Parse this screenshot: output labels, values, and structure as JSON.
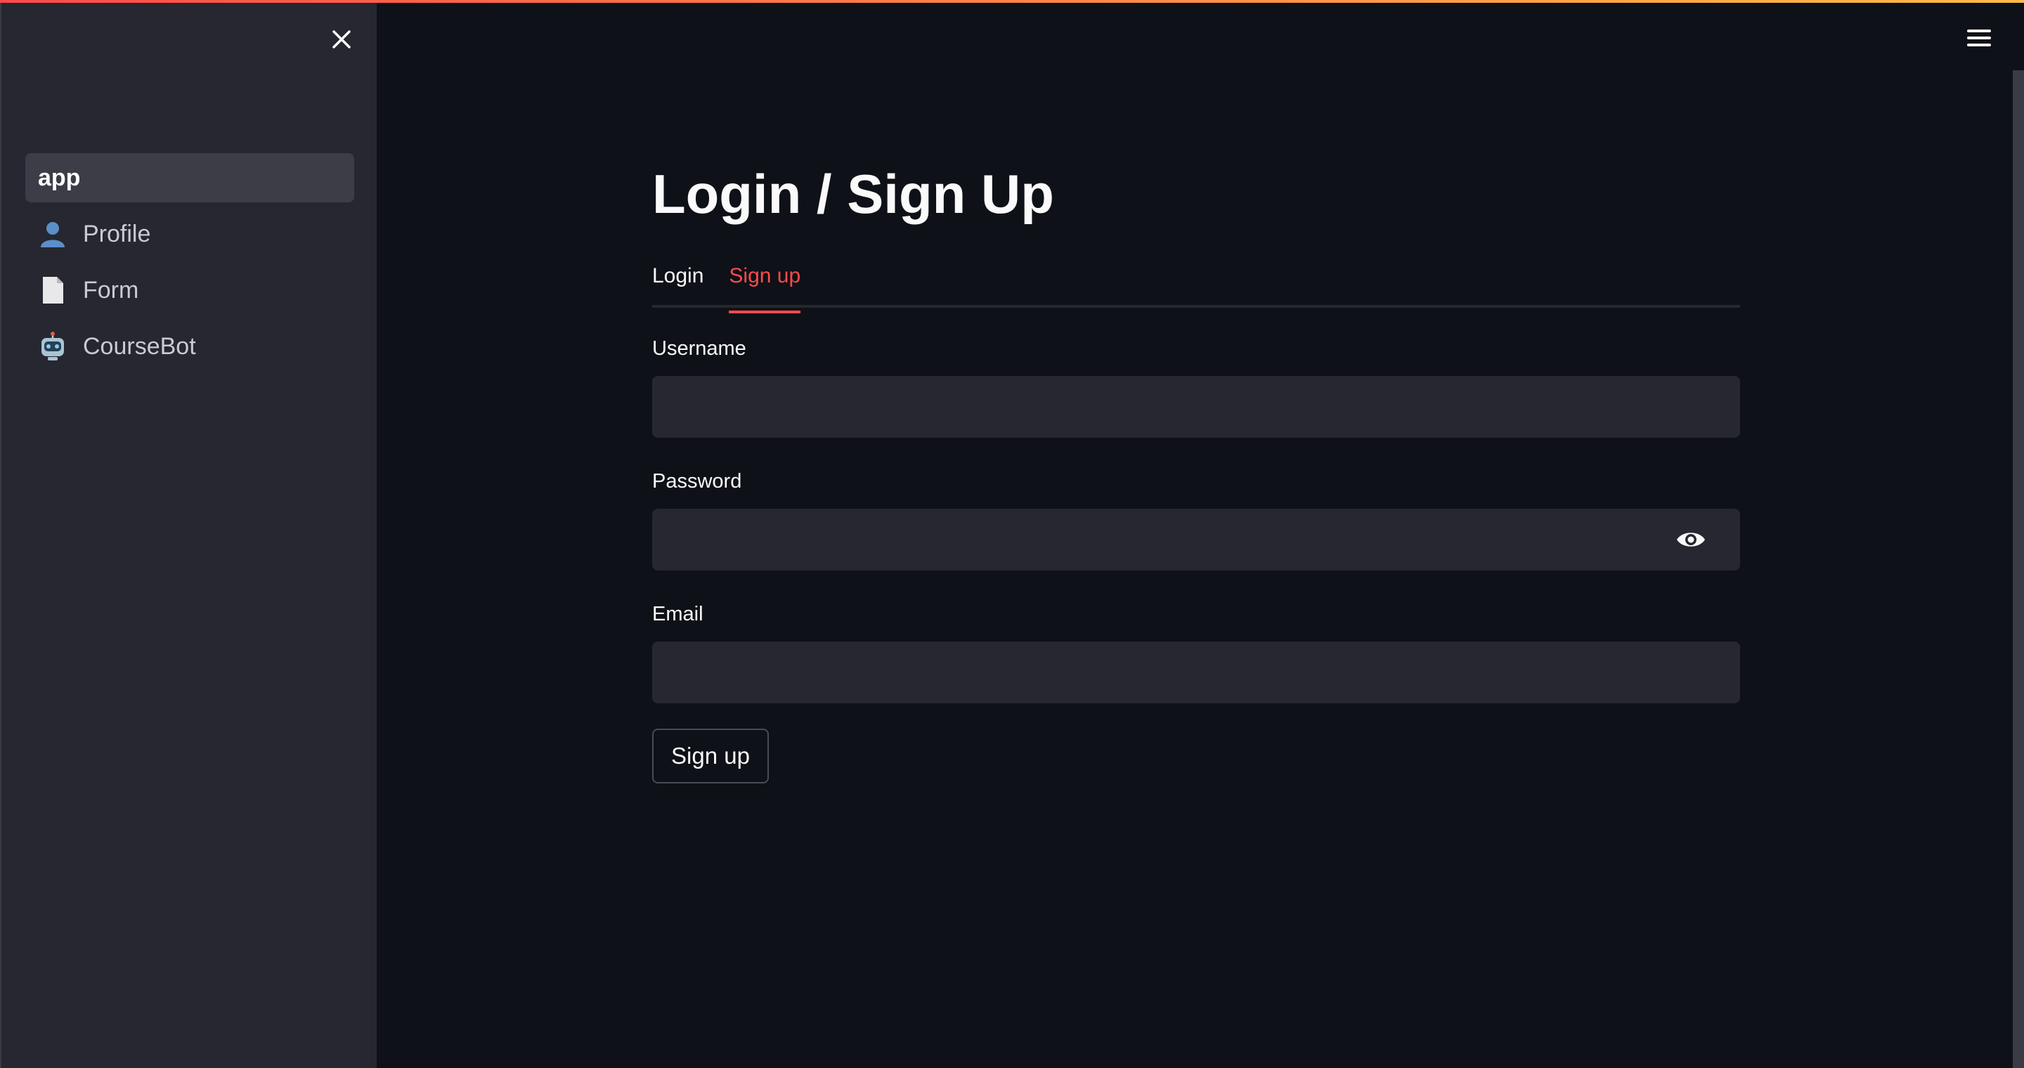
{
  "sidebar": {
    "items": [
      {
        "label": "app",
        "icon": ""
      },
      {
        "label": "Profile",
        "icon": "bust-in-silhouette-icon"
      },
      {
        "label": "Form",
        "icon": "page-icon"
      },
      {
        "label": "CourseBot",
        "icon": "robot-icon"
      }
    ]
  },
  "main": {
    "title": "Login / Sign Up",
    "tabs": [
      {
        "label": "Login",
        "active": false
      },
      {
        "label": "Sign up",
        "active": true
      }
    ],
    "form": {
      "username_label": "Username",
      "username_value": "",
      "password_label": "Password",
      "password_value": "",
      "email_label": "Email",
      "email_value": "",
      "submit_label": "Sign up"
    }
  },
  "colors": {
    "accent": "#ff4b4b",
    "background": "#0e1117",
    "sidebar": "#262730",
    "input": "#262730"
  }
}
